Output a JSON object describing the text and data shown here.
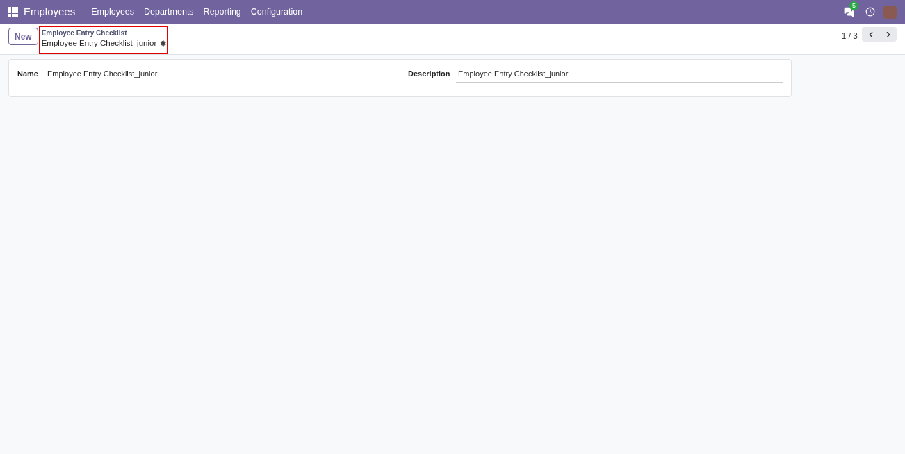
{
  "navbar": {
    "app_name": "Employees",
    "menu": [
      "Employees",
      "Departments",
      "Reporting",
      "Configuration"
    ],
    "messages_count": "5"
  },
  "control_panel": {
    "new_button": "New",
    "breadcrumb": {
      "parent": "Employee Entry Checklist",
      "current": "Employee Entry Checklist_junior",
      "highlighted": true
    },
    "pager": "1 / 3"
  },
  "form": {
    "fields": [
      {
        "label": "Name",
        "value": "Employee Entry Checklist_junior",
        "kind": "text"
      },
      {
        "label": "Description",
        "value": "Employee Entry Checklist_junior",
        "kind": "input"
      }
    ]
  }
}
